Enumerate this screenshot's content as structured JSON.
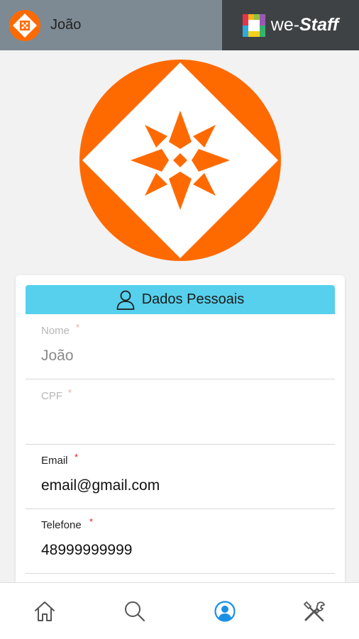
{
  "header": {
    "user_name": "João",
    "brand_prefix": "we-",
    "brand_name": "Staff"
  },
  "colors": {
    "brand_orange": "#ff6a00",
    "header_gray": "#7d8a93",
    "header_dark": "#3e4245",
    "section_cyan": "#56d0ec",
    "active_tab": "#1a8fe6",
    "required": "#e02020"
  },
  "section": {
    "title": "Dados Pessoais",
    "icon": "person-icon"
  },
  "fields": [
    {
      "label": "Nome",
      "required": "*",
      "value": "João",
      "placeholder": ""
    },
    {
      "label": "CPF",
      "required": "*",
      "value": "",
      "placeholder": ""
    },
    {
      "label": "Email",
      "required": "*",
      "value": "email@gmail.com",
      "placeholder": ""
    },
    {
      "label": "Telefone",
      "required": "*",
      "value": "48999999999",
      "placeholder": ""
    }
  ],
  "tabbar": {
    "active_tab": "profile",
    "tabs": [
      {
        "id": "home",
        "icon": "home-icon"
      },
      {
        "id": "search",
        "icon": "search-icon"
      },
      {
        "id": "profile",
        "icon": "user-circle-icon"
      },
      {
        "id": "tools",
        "icon": "tools-icon"
      }
    ]
  }
}
